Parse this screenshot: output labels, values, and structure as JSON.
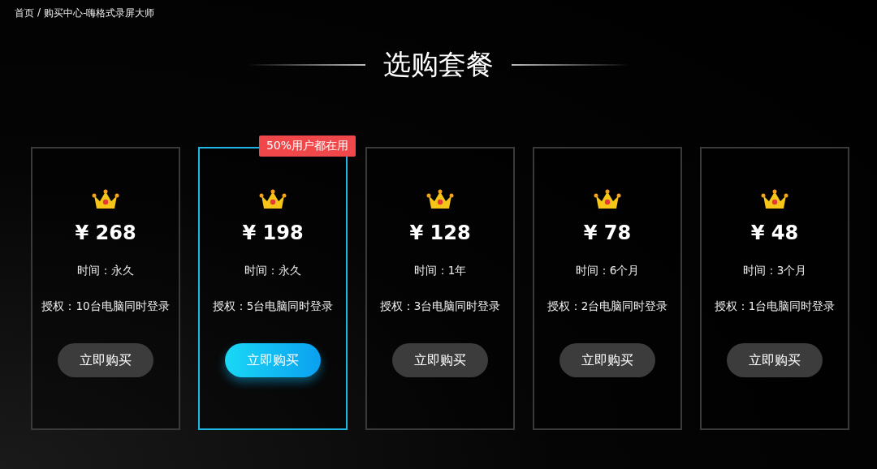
{
  "breadcrumb": {
    "items": [
      {
        "label": "首页"
      },
      {
        "label": "购买中心-嗨格式录屏大师"
      }
    ],
    "separator": "/"
  },
  "title": "选购套餐",
  "plans": [
    {
      "price": "¥ 268",
      "time": "时间：永久",
      "license": "授权：10台电脑同时登录",
      "button": "立即购买",
      "selected": false
    },
    {
      "price": "¥ 198",
      "time": "时间：永久",
      "license": "授权：5台电脑同时登录",
      "button": "立即购买",
      "selected": true,
      "badge": "50%用户都在用"
    },
    {
      "price": "¥ 128",
      "time": "时间：1年",
      "license": "授权：3台电脑同时登录",
      "button": "立即购买",
      "selected": false
    },
    {
      "price": "¥ 78",
      "time": "时间：6个月",
      "license": "授权：2台电脑同时登录",
      "button": "立即购买",
      "selected": false
    },
    {
      "price": "¥ 48",
      "time": "时间：3个月",
      "license": "授权：1台电脑同时登录",
      "button": "立即购买",
      "selected": false
    }
  ]
}
